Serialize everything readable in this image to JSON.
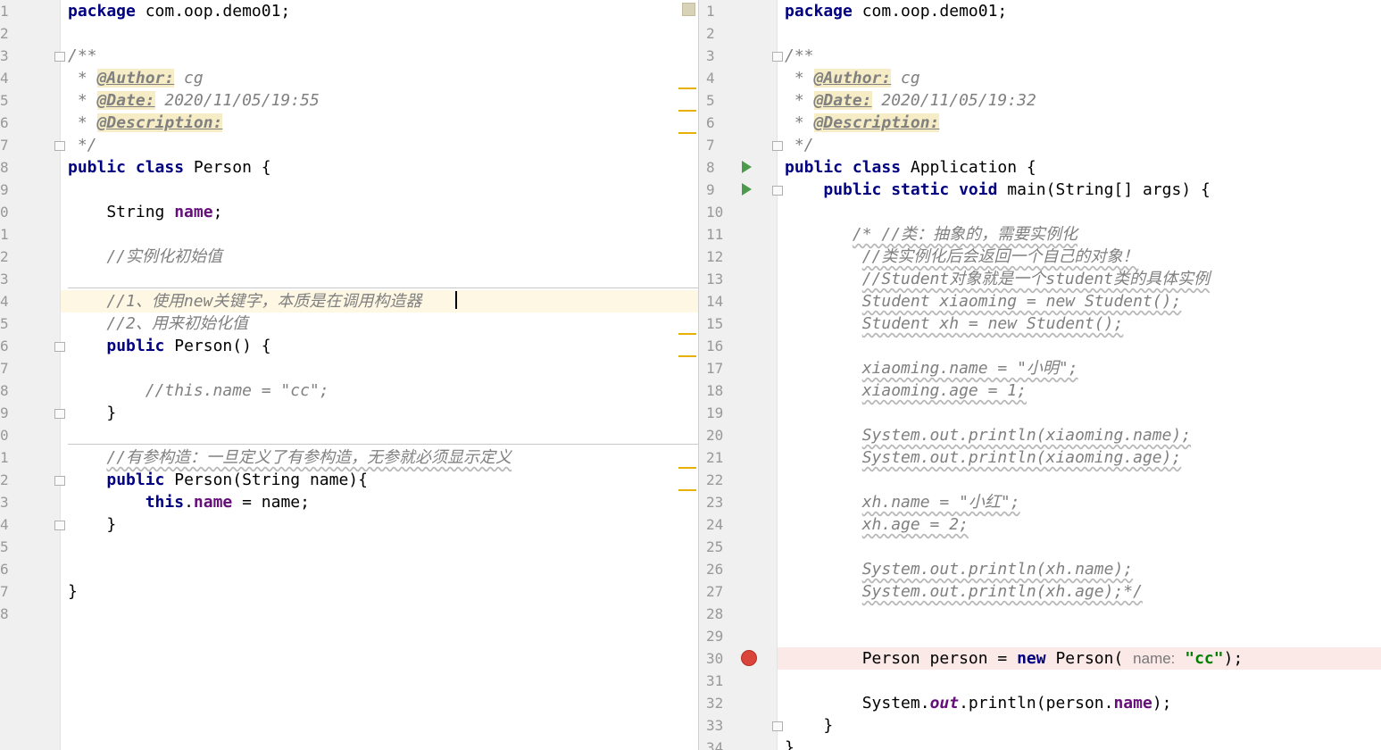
{
  "left": {
    "lines": [
      {
        "n": "1",
        "segs": [
          {
            "t": "package",
            "c": "kw"
          },
          {
            "t": " com.oop.demo01;"
          }
        ]
      },
      {
        "n": "2",
        "segs": []
      },
      {
        "n": "3",
        "segs": [
          {
            "t": "/**",
            "c": "cmt"
          }
        ]
      },
      {
        "n": "4",
        "segs": [
          {
            "t": " * ",
            "c": "cmt"
          },
          {
            "t": "@Author:",
            "c": "tag"
          },
          {
            "t": " cg",
            "c": "cmt"
          }
        ]
      },
      {
        "n": "5",
        "segs": [
          {
            "t": " * ",
            "c": "cmt"
          },
          {
            "t": "@Date:",
            "c": "tag"
          },
          {
            "t": " 2020/11/05/19:55",
            "c": "cmt"
          }
        ]
      },
      {
        "n": "6",
        "segs": [
          {
            "t": " * ",
            "c": "cmt"
          },
          {
            "t": "@Description:",
            "c": "tag"
          }
        ]
      },
      {
        "n": "7",
        "segs": [
          {
            "t": " */",
            "c": "cmt"
          }
        ]
      },
      {
        "n": "8",
        "segs": [
          {
            "t": "public class",
            "c": "kw"
          },
          {
            "t": " Person {"
          }
        ]
      },
      {
        "n": "9",
        "segs": []
      },
      {
        "n": "0",
        "segs": [
          {
            "t": "    String "
          },
          {
            "t": "name",
            "c": "fld"
          },
          {
            "t": ";"
          }
        ]
      },
      {
        "n": "1",
        "segs": []
      },
      {
        "n": "2",
        "segs": [
          {
            "t": "    //实例化初始值",
            "c": "cmt"
          }
        ]
      },
      {
        "n": "3",
        "segs": []
      },
      {
        "n": "4",
        "segs": [
          {
            "t": "    //1、使用new关键字，本质是在调用构造器",
            "c": "cmt"
          }
        ],
        "hl": "cur"
      },
      {
        "n": "5",
        "segs": [
          {
            "t": "    //2、用来初始化值",
            "c": "cmt"
          }
        ]
      },
      {
        "n": "6",
        "segs": [
          {
            "t": "    "
          },
          {
            "t": "public",
            "c": "kw"
          },
          {
            "t": " Person() {"
          }
        ]
      },
      {
        "n": "7",
        "segs": []
      },
      {
        "n": "8",
        "segs": [
          {
            "t": "        //this.name = \"cc\";",
            "c": "cmt"
          }
        ]
      },
      {
        "n": "9",
        "segs": [
          {
            "t": "    }"
          }
        ]
      },
      {
        "n": "0",
        "segs": []
      },
      {
        "n": "1",
        "segs": [
          {
            "t": "    "
          },
          {
            "t": "//有参构造：一旦定义了有参构造，无参就必须显示定义",
            "c": "cmt wavy"
          }
        ]
      },
      {
        "n": "2",
        "segs": [
          {
            "t": "    "
          },
          {
            "t": "public",
            "c": "kw"
          },
          {
            "t": " Person(String name){"
          }
        ]
      },
      {
        "n": "3",
        "segs": [
          {
            "t": "        "
          },
          {
            "t": "this",
            "c": "kw"
          },
          {
            "t": "."
          },
          {
            "t": "name",
            "c": "fld"
          },
          {
            "t": " = name;"
          }
        ]
      },
      {
        "n": "4",
        "segs": [
          {
            "t": "    }"
          }
        ]
      },
      {
        "n": "5",
        "segs": []
      },
      {
        "n": "6",
        "segs": []
      },
      {
        "n": "7",
        "segs": [
          {
            "t": "}"
          }
        ]
      },
      {
        "n": "8",
        "segs": []
      }
    ]
  },
  "right": {
    "lines": [
      {
        "n": "1",
        "segs": [
          {
            "t": "package",
            "c": "kw"
          },
          {
            "t": " com.oop.demo01;"
          }
        ]
      },
      {
        "n": "2",
        "segs": []
      },
      {
        "n": "3",
        "segs": [
          {
            "t": "/**",
            "c": "cmt"
          }
        ]
      },
      {
        "n": "4",
        "segs": [
          {
            "t": " * ",
            "c": "cmt"
          },
          {
            "t": "@Author:",
            "c": "tag"
          },
          {
            "t": " cg",
            "c": "cmt"
          }
        ]
      },
      {
        "n": "5",
        "segs": [
          {
            "t": " * ",
            "c": "cmt"
          },
          {
            "t": "@Date:",
            "c": "tag"
          },
          {
            "t": " 2020/11/05/19:32",
            "c": "cmt"
          }
        ]
      },
      {
        "n": "6",
        "segs": [
          {
            "t": " * ",
            "c": "cmt"
          },
          {
            "t": "@Description:",
            "c": "tag"
          }
        ]
      },
      {
        "n": "7",
        "segs": [
          {
            "t": " */",
            "c": "cmt"
          }
        ]
      },
      {
        "n": "8",
        "segs": [
          {
            "t": "public class",
            "c": "kw"
          },
          {
            "t": " Application {"
          }
        ]
      },
      {
        "n": "9",
        "segs": [
          {
            "t": "    "
          },
          {
            "t": "public static void",
            "c": "kw"
          },
          {
            "t": " main(String[] args) {"
          }
        ]
      },
      {
        "n": "10",
        "segs": []
      },
      {
        "n": "11",
        "segs": [
          {
            "t": "       "
          },
          {
            "t": "/* //类：抽象的，需要实例化",
            "c": "cmt wavy"
          }
        ]
      },
      {
        "n": "12",
        "segs": [
          {
            "t": "        "
          },
          {
            "t": "//类实例化后会返回一个自己的对象！",
            "c": "cmt wavy"
          }
        ]
      },
      {
        "n": "13",
        "segs": [
          {
            "t": "        "
          },
          {
            "t": "//Student对象就是一个student类的具体实例",
            "c": "cmt wavy"
          }
        ]
      },
      {
        "n": "14",
        "segs": [
          {
            "t": "        "
          },
          {
            "t": "Student xiaoming = new Student();",
            "c": "cmt wavy"
          }
        ]
      },
      {
        "n": "15",
        "segs": [
          {
            "t": "        "
          },
          {
            "t": "Student xh = new Student();",
            "c": "cmt wavy"
          }
        ]
      },
      {
        "n": "16",
        "segs": []
      },
      {
        "n": "17",
        "segs": [
          {
            "t": "        "
          },
          {
            "t": "xiaoming.name = \"小明\";",
            "c": "cmt wavy"
          }
        ]
      },
      {
        "n": "18",
        "segs": [
          {
            "t": "        "
          },
          {
            "t": "xiaoming.age = 1;",
            "c": "cmt wavy"
          }
        ]
      },
      {
        "n": "19",
        "segs": []
      },
      {
        "n": "20",
        "segs": [
          {
            "t": "        "
          },
          {
            "t": "System.out.println(xiaoming.name);",
            "c": "cmt wavy"
          }
        ]
      },
      {
        "n": "21",
        "segs": [
          {
            "t": "        "
          },
          {
            "t": "System.out.println(xiaoming.age);",
            "c": "cmt wavy"
          }
        ]
      },
      {
        "n": "22",
        "segs": []
      },
      {
        "n": "23",
        "segs": [
          {
            "t": "        "
          },
          {
            "t": "xh.name = \"小红\";",
            "c": "cmt wavy"
          }
        ]
      },
      {
        "n": "24",
        "segs": [
          {
            "t": "        "
          },
          {
            "t": "xh.age = 2;",
            "c": "cmt wavy"
          }
        ]
      },
      {
        "n": "25",
        "segs": []
      },
      {
        "n": "26",
        "segs": [
          {
            "t": "        "
          },
          {
            "t": "System.out.println(xh.name);",
            "c": "cmt wavy"
          }
        ]
      },
      {
        "n": "27",
        "segs": [
          {
            "t": "        "
          },
          {
            "t": "System.out.println(xh.age);*/",
            "c": "cmt wavy"
          }
        ]
      },
      {
        "n": "28",
        "segs": []
      },
      {
        "n": "29",
        "segs": []
      },
      {
        "n": "30",
        "segs": [
          {
            "t": "        Person person = "
          },
          {
            "t": "new",
            "c": "kw"
          },
          {
            "t": " Person( "
          },
          {
            "t": "name:",
            "c": "hint"
          },
          {
            "t": " "
          },
          {
            "t": "\"cc\"",
            "c": "str"
          },
          {
            "t": ");"
          }
        ],
        "hl": "bp"
      },
      {
        "n": "31",
        "segs": []
      },
      {
        "n": "32",
        "segs": [
          {
            "t": "        System."
          },
          {
            "t": "out",
            "c": "stat"
          },
          {
            "t": ".println(person."
          },
          {
            "t": "name",
            "c": "fld"
          },
          {
            "t": ");"
          }
        ]
      },
      {
        "n": "33",
        "segs": [
          {
            "t": "    }"
          }
        ]
      },
      {
        "n": "34",
        "segs": [
          {
            "t": "}"
          }
        ]
      }
    ]
  }
}
